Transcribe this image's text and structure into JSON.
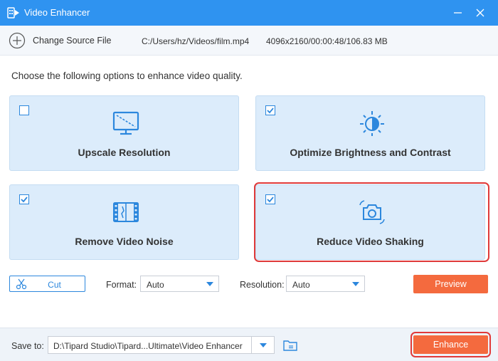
{
  "window": {
    "title": "Video Enhancer",
    "accent_color": "#2f93f0"
  },
  "source": {
    "change_label": "Change Source File",
    "path": "C:/Users/hz/Videos/film.mp4",
    "meta": "4096x2160/00:00:48/106.83 MB"
  },
  "instruction": "Choose the following options to enhance video quality.",
  "options": [
    {
      "label": "Upscale Resolution",
      "checked": false,
      "icon": "monitor-icon"
    },
    {
      "label": "Optimize Brightness and Contrast",
      "checked": true,
      "icon": "brightness-icon"
    },
    {
      "label": "Remove Video Noise",
      "checked": true,
      "icon": "film-noise-icon"
    },
    {
      "label": "Reduce Video Shaking",
      "checked": true,
      "icon": "camera-stabilize-icon"
    }
  ],
  "controls": {
    "cut_label": "Cut",
    "format_label": "Format:",
    "format_value": "Auto",
    "resolution_label": "Resolution:",
    "resolution_value": "Auto",
    "preview_label": "Preview"
  },
  "footer": {
    "save_label": "Save to:",
    "save_path": "D:\\Tipard Studio\\Tipard...Ultimate\\Video Enhancer",
    "enhance_label": "Enhance",
    "button_color": "#f46a3e",
    "highlight_color": "#e03a3a"
  }
}
